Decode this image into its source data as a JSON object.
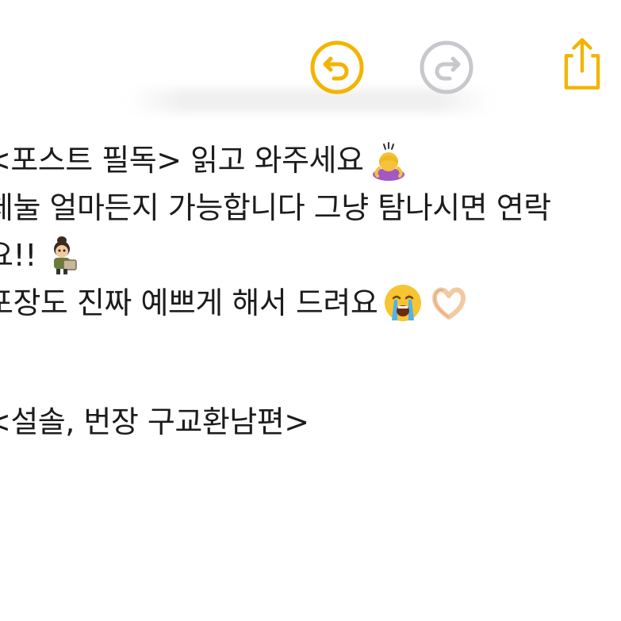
{
  "toolbar": {
    "accent_color": "#f3b400",
    "disabled_color": "#c7c7cc",
    "undo_icon": "undo-icon",
    "redo_icon": "redo-icon",
    "share_icon": "share-icon"
  },
  "note": {
    "lines": [
      {
        "text": "<포스트 필독> 읽고 와주세요",
        "emoji": "person-bowing-emoji"
      },
      {
        "text": "체눌 얼마든지 가능합니다 그냥 탐나시면 연락",
        "emoji": ""
      },
      {
        "text": "요!!",
        "emoji": "child-character-emoji"
      },
      {
        "text": "포장도 진짜 예쁘게 해서 드려요",
        "emoji": "crying-face-emoji",
        "emoji2": "heart-hands-emoji"
      },
      {
        "text": "",
        "emoji": ""
      },
      {
        "text": "<설솔, 번장 구교환남편>",
        "emoji": ""
      }
    ]
  }
}
